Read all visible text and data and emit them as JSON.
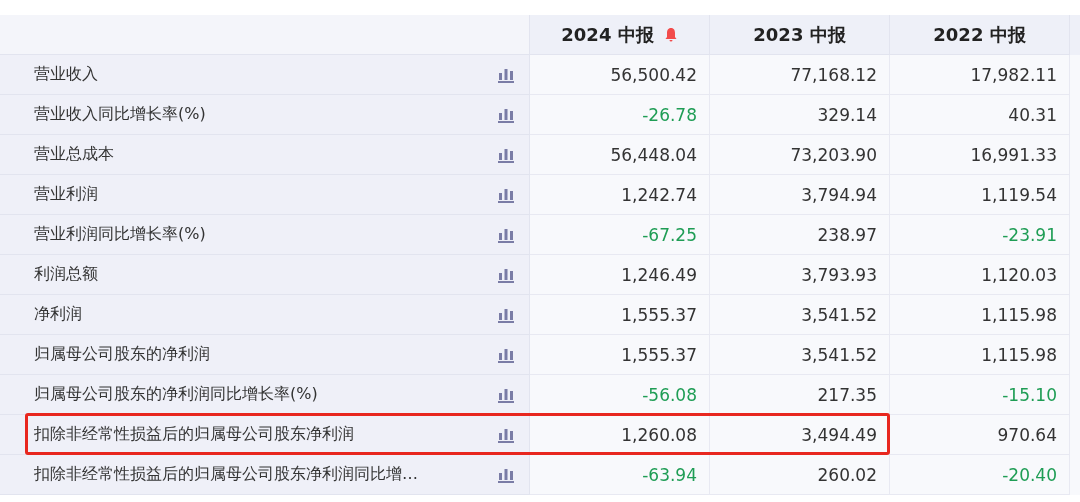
{
  "columns": [
    {
      "label": "2024 中报",
      "alert": true
    },
    {
      "label": "2023 中报",
      "alert": false
    },
    {
      "label": "2022 中报",
      "alert": false
    }
  ],
  "rows": [
    {
      "label": "营业收入",
      "highlighted": false,
      "cells": [
        {
          "value": "56,500.42",
          "negative": false
        },
        {
          "value": "77,168.12",
          "negative": false
        },
        {
          "value": "17,982.11",
          "negative": false
        }
      ]
    },
    {
      "label": "营业收入同比增长率(%)",
      "highlighted": false,
      "cells": [
        {
          "value": "-26.78",
          "negative": true
        },
        {
          "value": "329.14",
          "negative": false
        },
        {
          "value": "40.31",
          "negative": false
        }
      ]
    },
    {
      "label": "营业总成本",
      "highlighted": false,
      "cells": [
        {
          "value": "56,448.04",
          "negative": false
        },
        {
          "value": "73,203.90",
          "negative": false
        },
        {
          "value": "16,991.33",
          "negative": false
        }
      ]
    },
    {
      "label": "营业利润",
      "highlighted": false,
      "cells": [
        {
          "value": "1,242.74",
          "negative": false
        },
        {
          "value": "3,794.94",
          "negative": false
        },
        {
          "value": "1,119.54",
          "negative": false
        }
      ]
    },
    {
      "label": "营业利润同比增长率(%)",
      "highlighted": false,
      "cells": [
        {
          "value": "-67.25",
          "negative": true
        },
        {
          "value": "238.97",
          "negative": false
        },
        {
          "value": "-23.91",
          "negative": true
        }
      ]
    },
    {
      "label": "利润总额",
      "highlighted": false,
      "cells": [
        {
          "value": "1,246.49",
          "negative": false
        },
        {
          "value": "3,793.93",
          "negative": false
        },
        {
          "value": "1,120.03",
          "negative": false
        }
      ]
    },
    {
      "label": "净利润",
      "highlighted": false,
      "cells": [
        {
          "value": "1,555.37",
          "negative": false
        },
        {
          "value": "3,541.52",
          "negative": false
        },
        {
          "value": "1,115.98",
          "negative": false
        }
      ]
    },
    {
      "label": "归属母公司股东的净利润",
      "highlighted": false,
      "cells": [
        {
          "value": "1,555.37",
          "negative": false
        },
        {
          "value": "3,541.52",
          "negative": false
        },
        {
          "value": "1,115.98",
          "negative": false
        }
      ]
    },
    {
      "label": "归属母公司股东的净利润同比增长率(%)",
      "highlighted": false,
      "cells": [
        {
          "value": "-56.08",
          "negative": true
        },
        {
          "value": "217.35",
          "negative": false
        },
        {
          "value": "-15.10",
          "negative": true
        }
      ]
    },
    {
      "label": "扣除非经常性损益后的归属母公司股东净利润",
      "highlighted": true,
      "cells": [
        {
          "value": "1,260.08",
          "negative": false
        },
        {
          "value": "3,494.49",
          "negative": false
        },
        {
          "value": "970.64",
          "negative": false
        }
      ]
    },
    {
      "label": "扣除非经常性损益后的归属母公司股东净利润同比增…",
      "highlighted": false,
      "cells": [
        {
          "value": "-63.94",
          "negative": true
        },
        {
          "value": "260.02",
          "negative": false
        },
        {
          "value": "-20.40",
          "negative": true
        }
      ]
    }
  ]
}
